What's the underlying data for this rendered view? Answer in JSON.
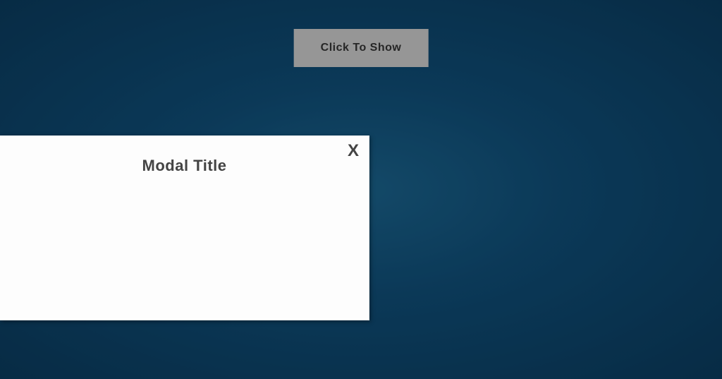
{
  "trigger": {
    "label": "Click To Show"
  },
  "modal": {
    "title": "Modal Title",
    "close_label": "X"
  }
}
